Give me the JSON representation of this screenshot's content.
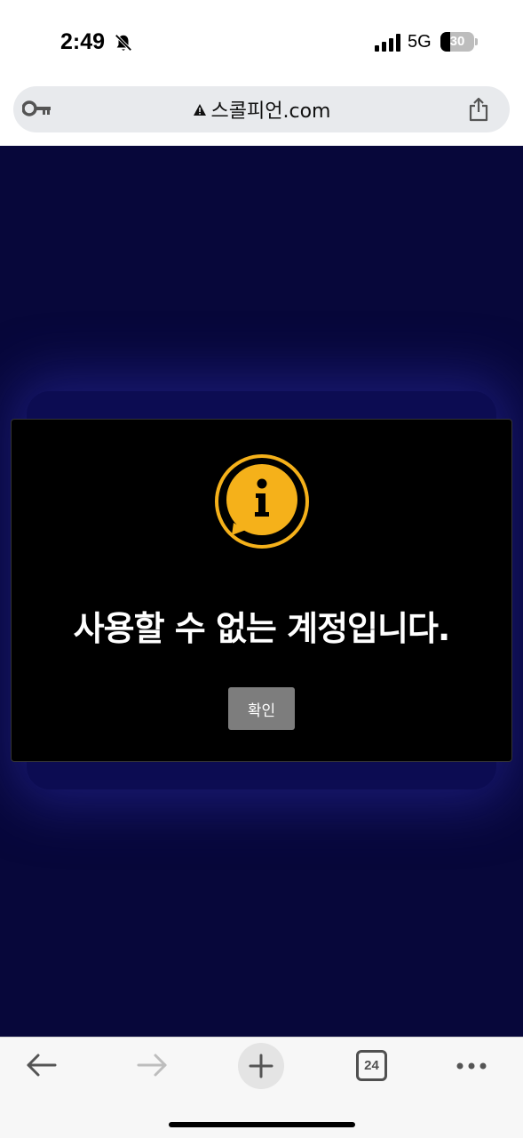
{
  "status_bar": {
    "time": "2:49",
    "network": "5G",
    "battery_level": 30,
    "battery_text": "30",
    "silent_icon": "bell-slash-icon",
    "signal_icon": "cellular-signal-icon"
  },
  "address_bar": {
    "url": "스콜피언.com",
    "left_icon": "key-icon",
    "security_icon": "warning-icon",
    "right_icon": "share-icon"
  },
  "modal": {
    "icon": "info-speech-bubble-icon",
    "message": "사용할 수 없는 계정입니다.",
    "confirm_label": "확인"
  },
  "toolbar": {
    "tab_count": "24",
    "icons": [
      "back-arrow-icon",
      "forward-arrow-icon",
      "plus-icon",
      "tabs-icon",
      "more-dots-icon"
    ]
  },
  "colors": {
    "page_background": "#07073a",
    "modal_background": "#000000",
    "accent": "#f5b11a",
    "button": "#7d7d7d"
  }
}
